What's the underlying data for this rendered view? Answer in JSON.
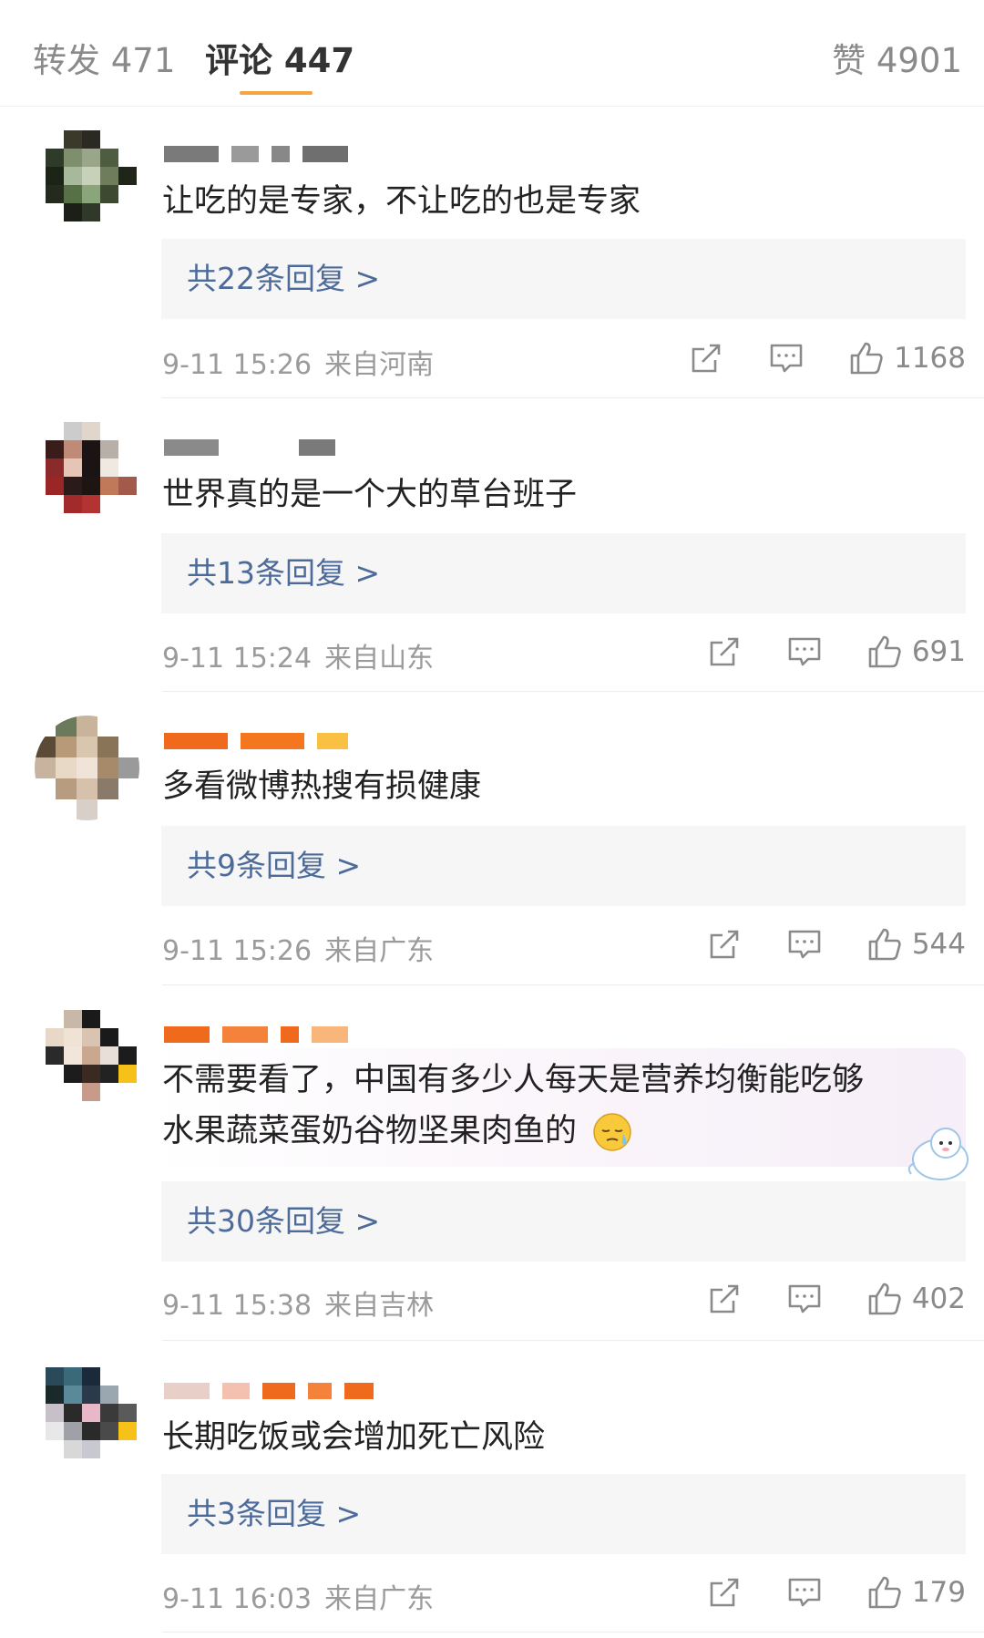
{
  "tabs": {
    "repost": "转发 471",
    "comment": "评论 447",
    "like": "赞 4901"
  },
  "comments": [
    {
      "text": "让吃的是专家，不让吃的也是专家",
      "replies": "共22条回复 >",
      "time": "9-11 15:26",
      "location": "来自河南",
      "likes": "1168"
    },
    {
      "text": "世界真的是一个大的草台班子",
      "replies": "共13条回复 >",
      "time": "9-11 15:24",
      "location": "来自山东",
      "likes": "691"
    },
    {
      "text": "多看微博热搜有损健康",
      "replies": "共9条回复 >",
      "time": "9-11 15:26",
      "location": "来自广东",
      "likes": "544"
    },
    {
      "text_line1": "不需要看了，中国有多少人每天是营养均衡能吃够",
      "text_line2": "水果蔬菜蛋奶谷物坚果肉鱼的",
      "replies": "共30条回复 >",
      "time": "9-11 15:38",
      "location": "来自吉林",
      "likes": "402"
    },
    {
      "text": "长期吃饭或会增加死亡风险",
      "replies": "共3条回复 >",
      "time": "9-11 16:03",
      "location": "来自广东",
      "likes": "179"
    }
  ],
  "icons": {
    "share": "share-icon",
    "comment": "comment-icon",
    "like": "thumbs-up-icon"
  },
  "colors": {
    "reply_link": "#4d6b9a",
    "tab_underline": "#f3a542",
    "reply_bg": "#f6f6f6"
  }
}
